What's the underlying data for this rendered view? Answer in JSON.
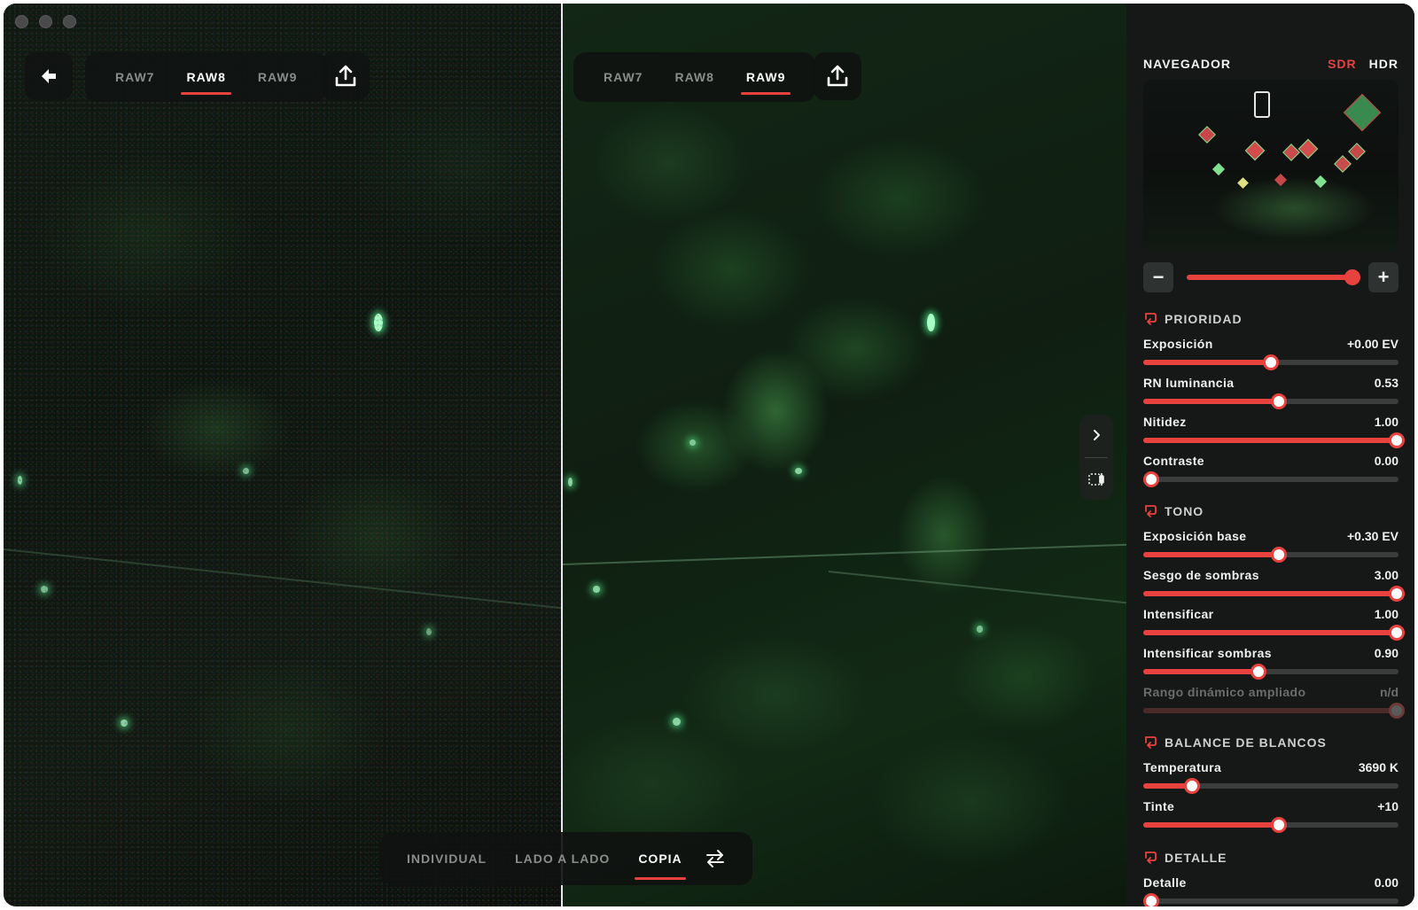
{
  "window": {
    "traffic_lights": [
      "close",
      "minimize",
      "zoom"
    ]
  },
  "left_pane": {
    "back_icon": "arrow-left-icon",
    "tabs": [
      {
        "label": "RAW7",
        "active": false
      },
      {
        "label": "RAW8",
        "active": true
      },
      {
        "label": "RAW9",
        "active": false
      }
    ],
    "share_icon": "share-icon"
  },
  "right_pane": {
    "tabs": [
      {
        "label": "RAW7",
        "active": false
      },
      {
        "label": "RAW8",
        "active": false
      },
      {
        "label": "RAW9",
        "active": true
      }
    ],
    "share_icon": "share-icon"
  },
  "view_switcher": {
    "modes": [
      {
        "label": "INDIVIDUAL",
        "active": false
      },
      {
        "label": "LADO A LADO",
        "active": false
      },
      {
        "label": "COPIA",
        "active": true
      }
    ],
    "swap_icon": "swap-arrows-icon"
  },
  "side_collapse": {
    "chevron_icon": "chevron-right-icon",
    "compare_icon": "compare-icon"
  },
  "panel": {
    "navigator": {
      "title": "NAVEGADOR",
      "mode_sdr": "SDR",
      "mode_hdr": "HDR",
      "active_mode": "SDR",
      "zoom_level": 1.0,
      "zoom_out_label": "−",
      "zoom_in_label": "+"
    },
    "sections": {
      "prioridad": {
        "title": "PRIORIDAD",
        "icon": "reset-icon",
        "rows": [
          {
            "label": "Exposición",
            "value": "+0.00 EV",
            "fraction": 0.5
          },
          {
            "label": "RN luminancia",
            "value": "0.53",
            "fraction": 0.53
          },
          {
            "label": "Nitidez",
            "value": "1.00",
            "fraction": 1.0
          },
          {
            "label": "Contraste",
            "value": "0.00",
            "fraction": 0.0
          }
        ]
      },
      "tono": {
        "title": "TONO",
        "icon": "reset-icon",
        "rows": [
          {
            "label": "Exposición base",
            "value": "+0.30 EV",
            "fraction": 0.53
          },
          {
            "label": "Sesgo de sombras",
            "value": "3.00",
            "fraction": 1.0
          },
          {
            "label": "Intensificar",
            "value": "1.00",
            "fraction": 1.0
          },
          {
            "label": "Intensificar sombras",
            "value": "0.90",
            "fraction": 0.45
          },
          {
            "label": "Rango dinámico ampliado",
            "value": "n/d",
            "fraction": 1.0,
            "disabled": true
          }
        ]
      },
      "balance": {
        "title": "BALANCE DE BLANCOS",
        "icon": "reset-icon",
        "rows": [
          {
            "label": "Temperatura",
            "value": "3690 K",
            "fraction": 0.19
          },
          {
            "label": "Tinte",
            "value": "+10",
            "fraction": 0.53
          }
        ]
      },
      "detalle": {
        "title": "DETALLE",
        "icon": "reset-icon",
        "rows": [
          {
            "label": "Detalle",
            "value": "0.00",
            "fraction": 0.0
          }
        ]
      }
    }
  },
  "colors": {
    "accent": "#e8423f",
    "panel_bg": "#161817",
    "track": "#3a3d3b"
  }
}
